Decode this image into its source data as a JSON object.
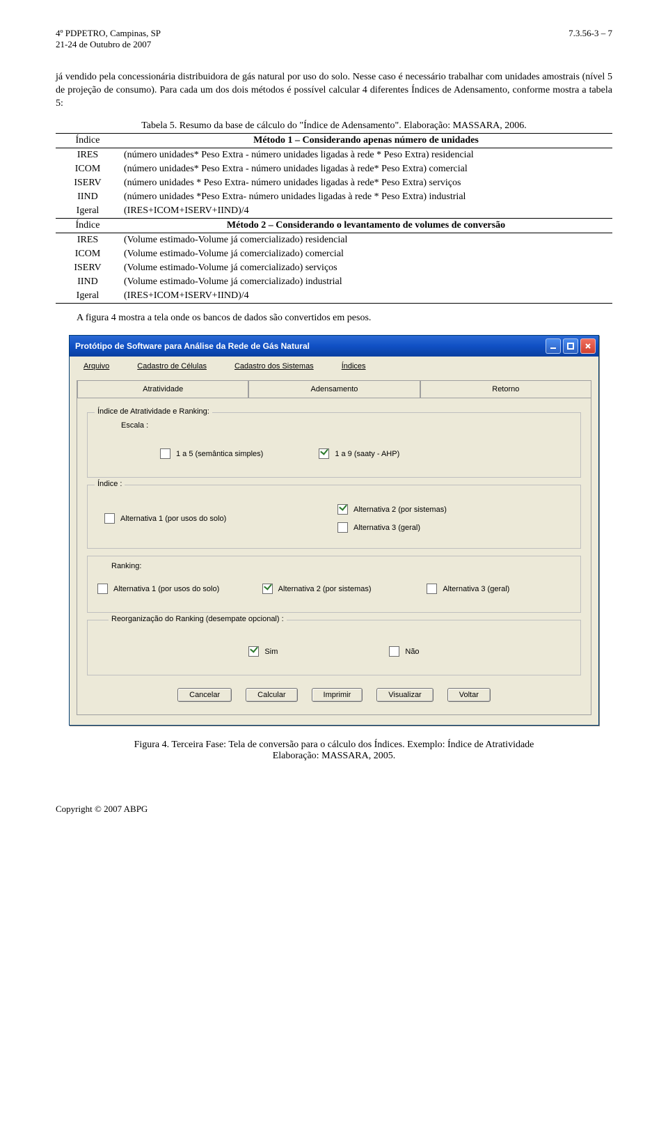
{
  "header": {
    "left1": "4º PDPETRO, Campinas, SP",
    "left2": "21-24 de Outubro de 2007",
    "right": "7.3.56-3 – 7"
  },
  "para1": "já vendido pela concessionária distribuidora de gás natural por uso do solo. Nesse caso é necessário trabalhar com unidades amostrais (nível 5 de projeção de consumo). Para cada um dos dois métodos é possível calcular 4 diferentes Índices de Adensamento, conforme mostra a tabela 5:",
  "table_caption": "Tabela 5. Resumo da base de cálculo do \"Índice de Adensamento\". Elaboração: MASSARA, 2006.",
  "table5": {
    "h1": {
      "idx": "Índice",
      "method": "Método 1 – Considerando apenas número de unidades"
    },
    "m1": [
      {
        "idx": "IRES",
        "val": "(número unidades* Peso Extra - número unidades ligadas à rede * Peso Extra) residencial"
      },
      {
        "idx": "ICOM",
        "val": "(número unidades* Peso Extra - número unidades ligadas à rede* Peso Extra) comercial"
      },
      {
        "idx": "ISERV",
        "val": "(número unidades * Peso Extra- número unidades ligadas à rede* Peso Extra) serviços"
      },
      {
        "idx": "IIND",
        "val": "(número unidades *Peso Extra- número unidades ligadas à rede * Peso Extra) industrial"
      },
      {
        "idx": "Igeral",
        "val": "(IRES+ICOM+ISERV+IIND)/4"
      }
    ],
    "h2": {
      "idx": "Índice",
      "method": "Método 2 – Considerando o levantamento de volumes de conversão"
    },
    "m2": [
      {
        "idx": "IRES",
        "val": "(Volume estimado-Volume já comercializado) residencial"
      },
      {
        "idx": "ICOM",
        "val": "(Volume estimado-Volume já comercializado) comercial"
      },
      {
        "idx": "ISERV",
        "val": "(Volume estimado-Volume já comercializado) serviços"
      },
      {
        "idx": "IIND",
        "val": "(Volume estimado-Volume já comercializado) industrial"
      },
      {
        "idx": "Igeral",
        "val": "(IRES+ICOM+ISERV+IIND)/4"
      }
    ]
  },
  "para2": "A figura 4 mostra a tela onde os bancos de dados são convertidos em pesos.",
  "app": {
    "title": "Protótipo de Software para Análise da Rede de Gás Natural",
    "menu": {
      "arquivo": "Arquivo",
      "cadcel": "Cadastro de Células",
      "cadsis": "Cadastro dos Sistemas",
      "indices": "Índices"
    },
    "tabs": {
      "atratividade": "Atratividade",
      "adensamento": "Adensamento",
      "retorno": "Retorno"
    },
    "group_main": "Índice de Atratividade e Ranking:",
    "escala": {
      "label": "Escala :",
      "opt1": "1 a 5 (semântica simples)",
      "opt2": "1 a 9 (saaty - AHP)"
    },
    "indice": {
      "label": "Índice :",
      "alt1": "Alternativa 1 (por usos do solo)",
      "alt2": "Alternativa 2 (por sistemas)",
      "alt3": "Alternativa 3 (geral)"
    },
    "ranking": {
      "label": "Ranking:",
      "alt1": "Alternativa 1 (por usos do solo)",
      "alt2": "Alternativa 2 (por sistemas)",
      "alt3": "Alternativa 3 (geral)"
    },
    "reorg": {
      "label": "Reorganização do Ranking (desempate opcional) :",
      "sim": "Sim",
      "nao": "Não"
    },
    "buttons": {
      "cancelar": "Cancelar",
      "calcular": "Calcular",
      "imprimir": "Imprimir",
      "visualizar": "Visualizar",
      "voltar": "Voltar"
    }
  },
  "fig_caption_l1": "Figura 4. Terceira Fase: Tela de conversão para o cálculo dos Índices. Exemplo: Índice de Atratividade",
  "fig_caption_l2": "Elaboração: MASSARA, 2005.",
  "footer": "Copyright © 2007 ABPG"
}
